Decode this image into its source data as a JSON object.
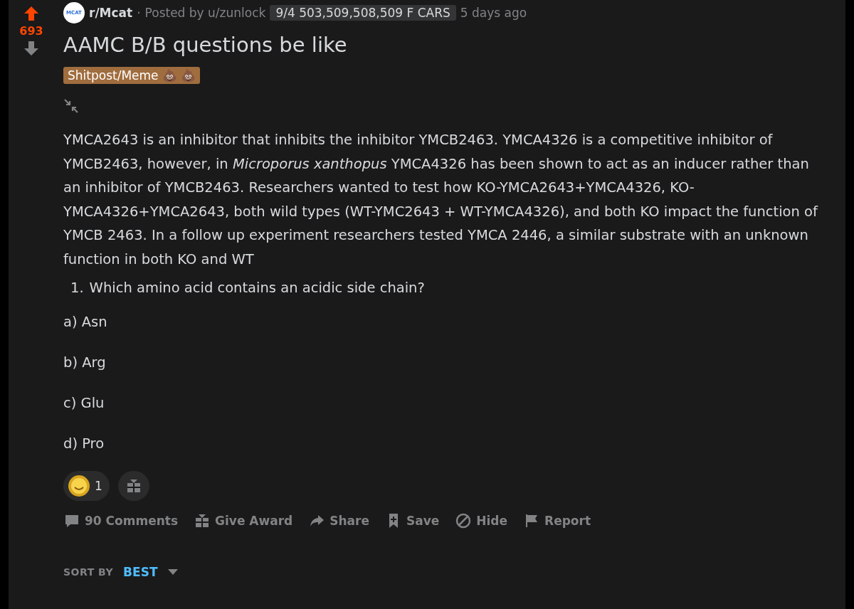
{
  "vote": {
    "score": "693",
    "upvoted": true,
    "downvoted": false
  },
  "header": {
    "community_icon": "MCAT",
    "community": "r/Mcat",
    "separator": "·",
    "posted_by": "Posted by u/zunlock",
    "user_flair": "9/4 503,509,508,509 F CARS",
    "time": "5 days ago"
  },
  "title": "AAMC B/B questions be like",
  "post_flair": "Shitpost/Meme 💩 💩",
  "body": "YMCA2643 is an inhibitor that inhibits the inhibitor YMCB2463. YMCA4326 is a competitive inhibitor of YMCB2463, however, in *Microporus xanthopus* YMCA4326 has been shown to act as an inducer rather than an inhibitor of YMCB2463. Researchers wanted to test how KO-YMCA2643+YMCA4326, KO-YMCA4326+YMCA2643, both wild types (WT-YMC2643 + WT-YMCA4326), and both KO impact the function of YMCB 2463. In a follow up experiment researchers tested YMCA 2446, a similar substrate with an unknown function in both KO and WT",
  "question": {
    "number": "1.",
    "text": "Which amino acid contains an acidic side chain?"
  },
  "options": [
    "a) Asn",
    "b) Arg",
    "c) Glu",
    "d) Pro"
  ],
  "awards": {
    "count": "1"
  },
  "actions": [
    {
      "kind": "comments",
      "label": "90 Comments"
    },
    {
      "kind": "award",
      "label": "Give Award"
    },
    {
      "kind": "share",
      "label": "Share"
    },
    {
      "kind": "save",
      "label": "Save"
    },
    {
      "kind": "hide",
      "label": "Hide"
    },
    {
      "kind": "report",
      "label": "Report"
    }
  ],
  "sort": {
    "label": "SORT BY",
    "value": "BEST"
  }
}
